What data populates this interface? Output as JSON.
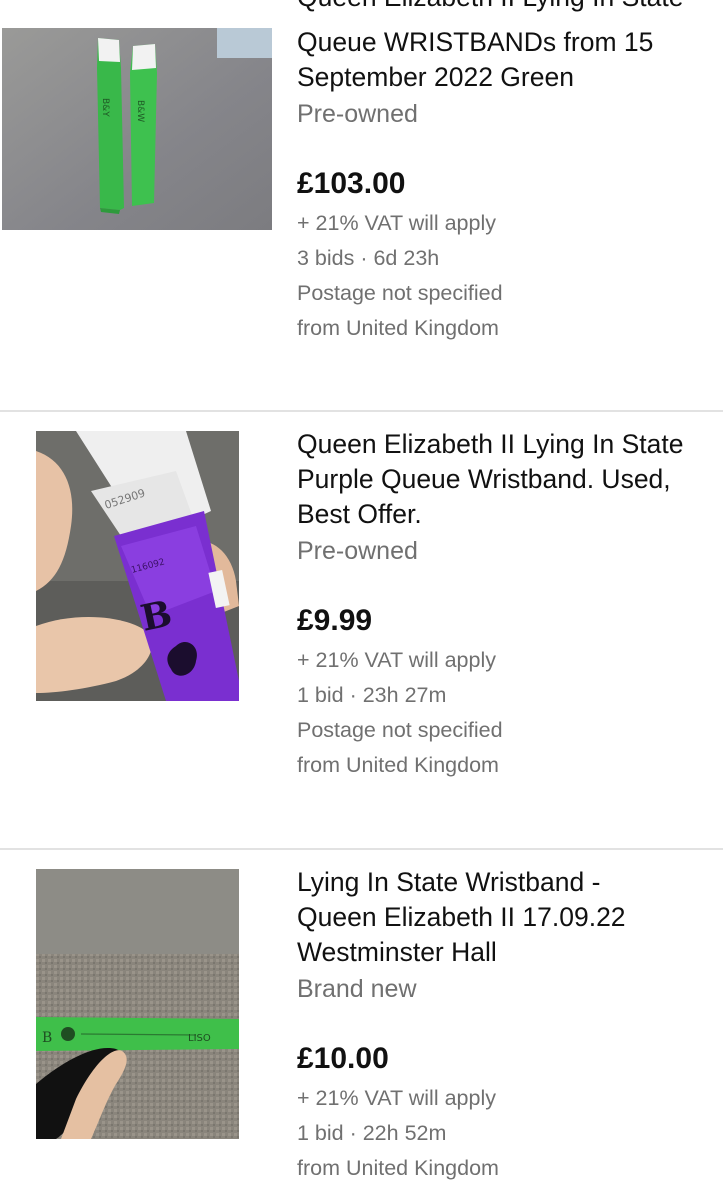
{
  "listings": [
    {
      "title_lines": [
        "Queen Elizabeth II Lying In State",
        "Queue WRISTBANDs from 15",
        "September 2022  Green"
      ],
      "condition": "Pre-owned",
      "price": "£103.00",
      "vat": "+ 21% VAT will apply",
      "bids_time": "3 bids · 6d 23h",
      "postage": "Postage not specified",
      "location": "from United Kingdom",
      "image": "green-wristbands-photo"
    },
    {
      "title_lines": [
        "Queen Elizabeth II Lying In State",
        "Purple Queue Wristband. Used,",
        "Best Offer."
      ],
      "condition": "Pre-owned",
      "price": "£9.99",
      "vat": "+ 21% VAT will apply",
      "bids_time": "1 bid · 23h 27m",
      "postage": "Postage not specified",
      "location": "from United Kingdom",
      "image": "purple-wristband-photo",
      "image_text": [
        "052909",
        "116092"
      ]
    },
    {
      "title_lines": [
        "Lying In State Wristband -",
        "Queen Elizabeth II 17.09.22",
        "Westminster Hall"
      ],
      "condition": "Brand new",
      "price": "£10.00",
      "vat": "+ 21% VAT will apply",
      "bids_time": "1 bid · 22h 52m",
      "location": "from United Kingdom",
      "image": "green-wristband-on-carpet-photo"
    }
  ],
  "colors": {
    "wristband_green": "#3fbf4a",
    "wristband_purple": "#7a2fd0",
    "secondary_text": "#707070",
    "divider": "#e2e2e2"
  }
}
